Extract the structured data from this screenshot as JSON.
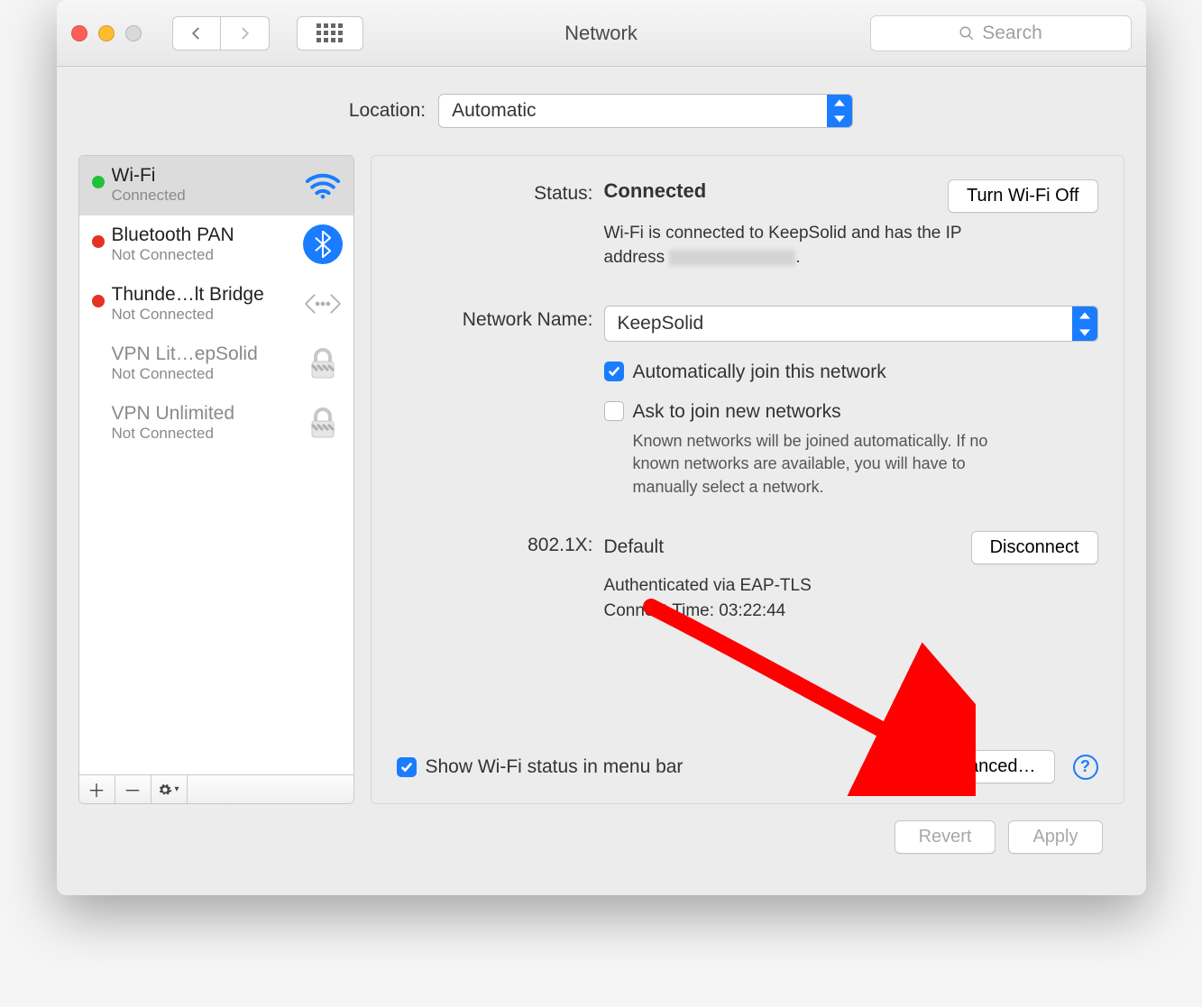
{
  "window": {
    "title": "Network"
  },
  "toolbar": {
    "search_placeholder": "Search"
  },
  "location": {
    "label": "Location:",
    "value": "Automatic"
  },
  "services": [
    {
      "name": "Wi-Fi",
      "status": "Connected",
      "dot": "green",
      "icon": "wifi",
      "selected": true
    },
    {
      "name": "Bluetooth PAN",
      "status": "Not Connected",
      "dot": "red",
      "icon": "bluetooth",
      "selected": false
    },
    {
      "name": "Thunde…lt Bridge",
      "status": "Not Connected",
      "dot": "red",
      "icon": "thunderbolt",
      "selected": false
    },
    {
      "name": "VPN Lit…epSolid",
      "status": "Not Connected",
      "dot": "none",
      "icon": "lock",
      "selected": false
    },
    {
      "name": "VPN Unlimited",
      "status": "Not Connected",
      "dot": "none",
      "icon": "lock",
      "selected": false
    }
  ],
  "detail": {
    "status_label": "Status:",
    "status_value": "Connected",
    "wifi_toggle_label": "Turn Wi-Fi Off",
    "status_desc_prefix": "Wi-Fi is connected to KeepSolid and has the IP address ",
    "status_desc_suffix": ".",
    "network_name_label": "Network Name:",
    "network_name_value": "KeepSolid",
    "auto_join_label": "Automatically join this network",
    "auto_join_checked": true,
    "ask_join_label": "Ask to join new networks",
    "ask_join_checked": false,
    "ask_join_hint": "Known networks will be joined automatically. If no known networks are available, you will have to manually select a network.",
    "eap_label": "802.1X:",
    "eap_value": "Default",
    "disconnect_label": "Disconnect",
    "eap_auth": "Authenticated via EAP-TLS",
    "eap_time": "Connect Time: 03:22:44",
    "show_menubar_label": "Show Wi-Fi status in menu bar",
    "show_menubar_checked": true,
    "advanced_label": "Advanced…"
  },
  "footer": {
    "revert": "Revert",
    "apply": "Apply"
  }
}
